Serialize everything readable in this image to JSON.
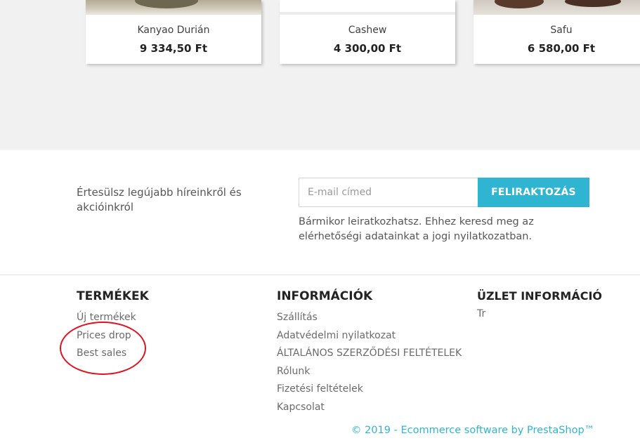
{
  "products": [
    {
      "name": "Kanyao Durián",
      "price": "9 334,50 Ft",
      "image": "nut"
    },
    {
      "name": "Cashew",
      "price": "4 300,00 Ft",
      "image": "blank"
    },
    {
      "name": "Safu",
      "price": "6 580,00 Ft",
      "image": "safu"
    }
  ],
  "newsletter": {
    "text": "Értesülsz legújabb híreinkről és akcióinkról",
    "email_placeholder": "E-mail címed",
    "subscribe_label": "FELIRAKTOZÁS",
    "note": "Bármikor leiratkozhatsz. Ehhez keresd meg az elérhetőségi adatainkat a jogi nyilatkozatban."
  },
  "footer": {
    "products_title": "TERMÉKEK",
    "products_links": [
      "Új termékek",
      "Prices drop",
      "Best sales"
    ],
    "info_title": "INFORMÁCIÓK",
    "info_links": [
      "Szállítás",
      "Adatvédelmi nyilatkozat",
      "ÁLTALÁNOS SZERZŐDÉSI FELTÉTELEK",
      "Rólunk",
      "Fizetési feltételek",
      "Kapcsolat"
    ],
    "store_title": "ÜZLET INFORMÁCIÓ",
    "store_text": "Tr",
    "copyright": "© 2019 - Ecommerce software by PrestaShop™"
  },
  "colors": {
    "accent": "#2fb5d2",
    "annotation": "#e0141f",
    "page_bg": "#f1f1f1"
  }
}
